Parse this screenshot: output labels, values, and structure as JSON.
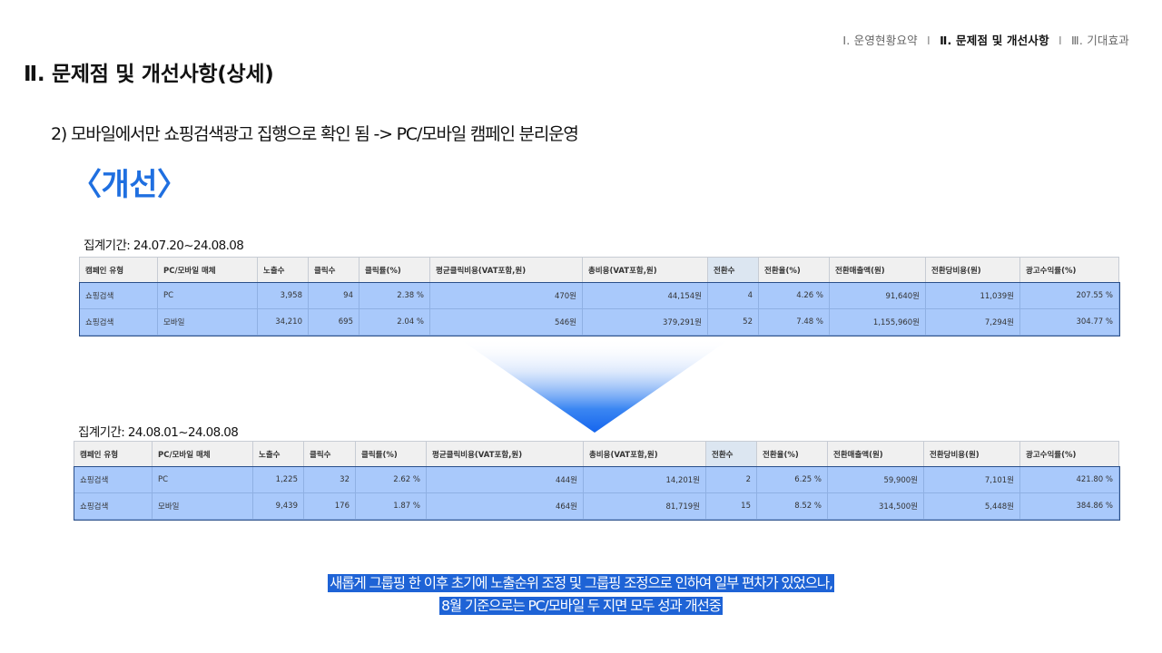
{
  "nav": {
    "item1": "Ⅰ. 운영현황요약",
    "item2": "Ⅱ. 문제점 및 개선사항",
    "item3": "Ⅲ. 기대효과",
    "sep1": "I",
    "sep2": "I"
  },
  "page_title": "Ⅱ. 문제점 및 개선사항(상세)",
  "subtitle": "2) 모바일에서만 쇼핑검색광고 집행으로 확인 됨 -> PC/모바일 캠페인 분리운영",
  "improve_heading": "〈개선〉",
  "headers": [
    "캠페인 유형",
    "PC/모바일 매체",
    "노출수",
    "클릭수",
    "클릭률(%)",
    "평균클릭비용(VAT포함,원)",
    "총비용(VAT포함,원)",
    "전환수",
    "전환율(%)",
    "전환매출액(원)",
    "전환당비용(원)",
    "광고수익률(%)"
  ],
  "before": {
    "period": "집계기간: 24.07.20~24.08.08",
    "rows": [
      [
        "쇼핑검색",
        "PC",
        "3,958",
        "94",
        "2.38 %",
        "470원",
        "44,154원",
        "4",
        "4.26 %",
        "91,640원",
        "11,039원",
        "207.55 %"
      ],
      [
        "쇼핑검색",
        "모바일",
        "34,210",
        "695",
        "2.04 %",
        "546원",
        "379,291원",
        "52",
        "7.48 %",
        "1,155,960원",
        "7,294원",
        "304.77 %"
      ]
    ]
  },
  "after": {
    "period": "집계기간: 24.08.01~24.08.08",
    "rows": [
      [
        "쇼핑검색",
        "PC",
        "1,225",
        "32",
        "2.62 %",
        "444원",
        "14,201원",
        "2",
        "6.25 %",
        "59,900원",
        "7,101원",
        "421.80 %"
      ],
      [
        "쇼핑검색",
        "모바일",
        "9,439",
        "176",
        "1.87 %",
        "464원",
        "81,719원",
        "15",
        "8.52 %",
        "314,500원",
        "5,448원",
        "384.86 %"
      ]
    ]
  },
  "footer": {
    "line1": "새롭게 그룹핑 한 이후 초기에 노출순위 조정 및 그룹핑 조정으로 인하여 일부 편차가 있었으나,",
    "line2": "8월 기준으로는 PC/모바일 두 지면 모두 성과 개선중"
  },
  "colors": {
    "accent": "#1f6fe0",
    "table_highlight": "#a9c9fb",
    "footer_highlight": "#1e63d6"
  }
}
